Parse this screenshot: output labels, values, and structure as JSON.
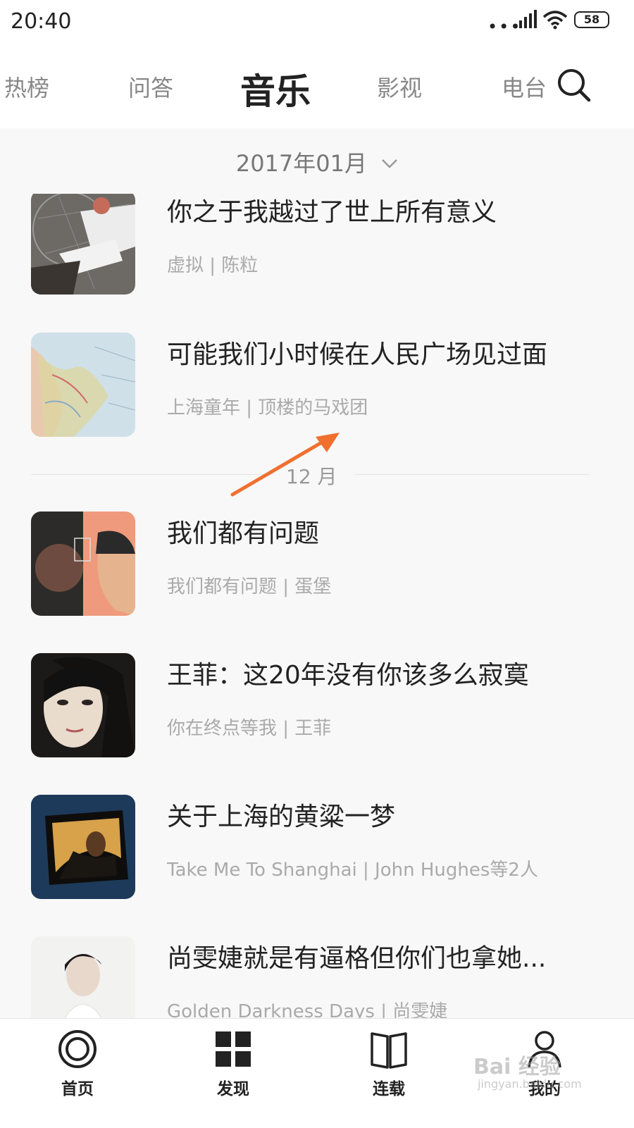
{
  "status_bar": {
    "time": "20:40",
    "battery": "58"
  },
  "top_nav": {
    "tabs": [
      {
        "label": "热榜"
      },
      {
        "label": "问答"
      },
      {
        "label": "音乐"
      },
      {
        "label": "影视"
      },
      {
        "label": "电台"
      }
    ],
    "active_tab": "音乐"
  },
  "month_selector": {
    "label": "2017年01月"
  },
  "section_divider": {
    "label": "12 月"
  },
  "items": [
    {
      "title": "你之于我越过了世上所有意义",
      "subtitle": "虚拟 | 陈粒"
    },
    {
      "title": "可能我们小时候在人民广场见过面",
      "subtitle": "上海童年 | 顶楼的马戏团"
    },
    {
      "title": "我们都有问题",
      "subtitle": "我们都有问题 | 蛋堡"
    },
    {
      "title": "王菲：这20年没有你该多么寂寞",
      "subtitle": "你在终点等我 | 王菲"
    },
    {
      "title": "关于上海的黄粱一梦",
      "subtitle": "Take Me To Shanghai | John Hughes等2人"
    },
    {
      "title": "尚雯婕就是有逼格但你们也拿她...",
      "subtitle": "Golden Darkness Days | 尚雯婕"
    }
  ],
  "bottom_nav": [
    {
      "label": "首页",
      "icon": "home-disc-icon"
    },
    {
      "label": "发现",
      "icon": "discover-grid-icon"
    },
    {
      "label": "连载",
      "icon": "book-icon"
    },
    {
      "label": "我的",
      "icon": "user-icon"
    }
  ],
  "watermark": {
    "text": "Bai 经验",
    "sub": "jingyan.baidu.com"
  },
  "colors": {
    "accent_arrow": "#f07030",
    "text_primary": "#222222",
    "text_secondary": "#aaaaaa"
  }
}
